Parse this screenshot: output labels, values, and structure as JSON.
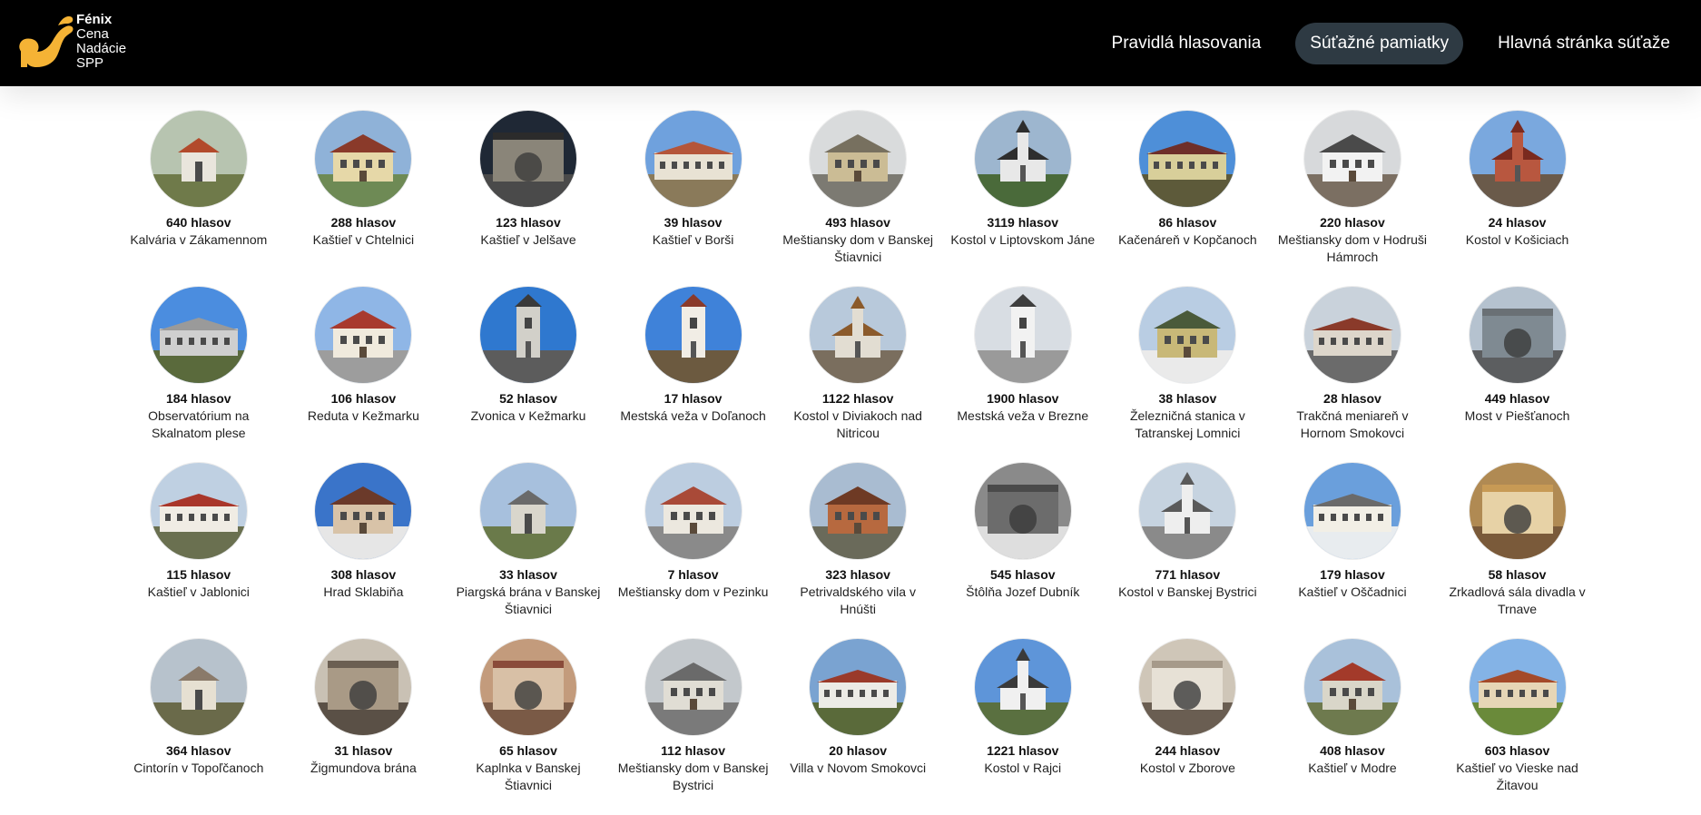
{
  "header": {
    "brand": [
      "Fénix",
      "Cena",
      "Nadácie",
      "SPP"
    ],
    "nav": [
      {
        "label": "Pravidlá hlasovania",
        "active": false
      },
      {
        "label": "Súťažné pamiatky",
        "active": true
      },
      {
        "label": "Hlavná stránka súťaže",
        "active": false
      }
    ]
  },
  "items": [
    {
      "votes": "640 hlasov",
      "name": "Kalvária v Zákamennom",
      "sky": "#b7c4b0",
      "ground": "#6f7a4a",
      "bld": "#e9e5dc",
      "roof": "#b24a2b",
      "shape": "chapel"
    },
    {
      "votes": "288 hlasov",
      "name": "Kaštieľ v Chtelnici",
      "sky": "#8fb2d8",
      "ground": "#6e8a55",
      "bld": "#e6d8a8",
      "roof": "#8a3a2a",
      "shape": "house"
    },
    {
      "votes": "123 hlasov",
      "name": "Kaštieľ v Jelšave",
      "sky": "#1f2835",
      "ground": "#4a4a4a",
      "bld": "#8a8579",
      "roof": "#2b2b2b",
      "shape": "wall"
    },
    {
      "votes": "39 hlasov",
      "name": "Kaštieľ v Borši",
      "sky": "#6fa1dd",
      "ground": "#8a7a5a",
      "bld": "#e8e2d4",
      "roof": "#b4553a",
      "shape": "long"
    },
    {
      "votes": "493 hlasov",
      "name": "Meštiansky dom v Banskej Štiavnici",
      "sky": "#d9dbdc",
      "ground": "#7c7a72",
      "bld": "#cbbc95",
      "roof": "#77705f",
      "shape": "house"
    },
    {
      "votes": "3119 hlasov",
      "name": "Kostol v Liptovskom Jáne",
      "sky": "#9db6cf",
      "ground": "#4a6a3a",
      "bld": "#e8e8e8",
      "roof": "#2e2e2e",
      "shape": "church"
    },
    {
      "votes": "86 hlasov",
      "name": "Kačenáreň v Kopčanoch",
      "sky": "#4e8fd8",
      "ground": "#5d5a3a",
      "bld": "#d8cf9a",
      "roof": "#6e2f2a",
      "shape": "long"
    },
    {
      "votes": "220 hlasov",
      "name": "Meštiansky dom v Hodruši Hámroch",
      "sky": "#d7d9db",
      "ground": "#7b6f62",
      "bld": "#f2f2f2",
      "roof": "#4a4a4a",
      "shape": "house"
    },
    {
      "votes": "24 hlasov",
      "name": "Kostol v Košiciach",
      "sky": "#7aa8de",
      "ground": "#6a5a4a",
      "bld": "#b8573f",
      "roof": "#7a2a1e",
      "shape": "church"
    },
    {
      "votes": "184 hlasov",
      "name": "Observatórium na Skalnatom plese",
      "sky": "#4b8ddf",
      "ground": "#5a6a3c",
      "bld": "#cfcfcf",
      "roof": "#9a9a9a",
      "shape": "long"
    },
    {
      "votes": "106 hlasov",
      "name": "Reduta v Kežmarku",
      "sky": "#8fb6e6",
      "ground": "#9d9d9d",
      "bld": "#f0eadd",
      "roof": "#a83a2e",
      "shape": "house"
    },
    {
      "votes": "52 hlasov",
      "name": "Zvonica v Kežmarku",
      "sky": "#2f78cf",
      "ground": "#5c5c5c",
      "bld": "#d2d0c9",
      "roof": "#3a3a3a",
      "shape": "tower"
    },
    {
      "votes": "17 hlasov",
      "name": "Mestská veža v Doľanoch",
      "sky": "#3f82d9",
      "ground": "#6c5a40",
      "bld": "#f1ede5",
      "roof": "#8a3a2a",
      "shape": "tower"
    },
    {
      "votes": "1122 hlasov",
      "name": "Kostol v Diviakoch nad Nitricou",
      "sky": "#b8c9db",
      "ground": "#7a6e5e",
      "bld": "#e2ddd2",
      "roof": "#8b5a2b",
      "shape": "church"
    },
    {
      "votes": "1900 hlasov",
      "name": "Mestská veža v Brezne",
      "sky": "#d8dde3",
      "ground": "#9a9a9a",
      "bld": "#f2f2f2",
      "roof": "#3e3e3e",
      "shape": "tower"
    },
    {
      "votes": "38 hlasov",
      "name": "Železničná stanica v Tatranskej Lomnici",
      "sky": "#b9cde3",
      "ground": "#eaeaea",
      "bld": "#c8b878",
      "roof": "#4a5a3a",
      "shape": "house"
    },
    {
      "votes": "28 hlasov",
      "name": "Trakčná meniareň v Hornom Smokovci",
      "sky": "#c9d2db",
      "ground": "#6b6b6b",
      "bld": "#ddd6cb",
      "roof": "#8a3a2a",
      "shape": "long"
    },
    {
      "votes": "449 hlasov",
      "name": "Most v Piešťanoch",
      "sky": "#b5c2cf",
      "ground": "#5c5e60",
      "bld": "#7f8a92",
      "roof": "#6a7075",
      "shape": "wall"
    },
    {
      "votes": "115 hlasov",
      "name": "Kaštieľ v Jablonici",
      "sky": "#bfd0e2",
      "ground": "#6a7050",
      "bld": "#f0ece4",
      "roof": "#a9362a",
      "shape": "long"
    },
    {
      "votes": "308 hlasov",
      "name": "Hrad Sklabiňa",
      "sky": "#3a74c9",
      "ground": "#e6e6e6",
      "bld": "#d8c3a8",
      "roof": "#6b3a2a",
      "shape": "house"
    },
    {
      "votes": "33 hlasov",
      "name": "Piargská brána v Banskej Štiavnici",
      "sky": "#a7c0dd",
      "ground": "#6a7a4a",
      "bld": "#d9d6cc",
      "roof": "#6a6a6a",
      "shape": "chapel"
    },
    {
      "votes": "7 hlasov",
      "name": "Meštiansky dom v Pezinku",
      "sky": "#bccde0",
      "ground": "#8a8a8a",
      "bld": "#ece8df",
      "roof": "#a94a38",
      "shape": "house"
    },
    {
      "votes": "323 hlasov",
      "name": "Petrivaldského vila v Hnúšti",
      "sky": "#a9bcd1",
      "ground": "#6a6a5a",
      "bld": "#b7693f",
      "roof": "#6e3a24",
      "shape": "house"
    },
    {
      "votes": "545 hlasov",
      "name": "Štôlňa Jozef Dubník",
      "sky": "#8a8a8a",
      "ground": "#dedede",
      "bld": "#6c6c6c",
      "roof": "#4a4a4a",
      "shape": "wall"
    },
    {
      "votes": "771 hlasov",
      "name": "Kostol v Banskej Bystrici",
      "sky": "#c6d3e0",
      "ground": "#8a8a8a",
      "bld": "#eeeeee",
      "roof": "#5a5a5a",
      "shape": "church"
    },
    {
      "votes": "179 hlasov",
      "name": "Kaštieľ v Oščadnici",
      "sky": "#6a9fdc",
      "ground": "#e8ecef",
      "bld": "#f2efe6",
      "roof": "#6a6a6a",
      "shape": "long"
    },
    {
      "votes": "58 hlasov",
      "name": "Zrkadlová sála divadla v Trnave",
      "sky": "#b08a53",
      "ground": "#7a5a3a",
      "bld": "#e7d2a6",
      "roof": "#c79a55",
      "shape": "wall"
    },
    {
      "votes": "364 hlasov",
      "name": "Cintorín v Topoľčanoch",
      "sky": "#b7c2cc",
      "ground": "#6a6a4a",
      "bld": "#e6e0d2",
      "roof": "#8a7a6a",
      "shape": "chapel"
    },
    {
      "votes": "31 hlasov",
      "name": "Žigmundova brána",
      "sky": "#c9c1b4",
      "ground": "#5a5046",
      "bld": "#a99a86",
      "roof": "#6b5f52",
      "shape": "wall"
    },
    {
      "votes": "65 hlasov",
      "name": "Kaplnka v Banskej Štiavnici",
      "sky": "#c39b7c",
      "ground": "#7a5a46",
      "bld": "#d8c0a6",
      "roof": "#8a4b3a",
      "shape": "wall"
    },
    {
      "votes": "112 hlasov",
      "name": "Meštiansky dom v Banskej Bystrici",
      "sky": "#c3c8cc",
      "ground": "#7a7a7a",
      "bld": "#e0ddd4",
      "roof": "#6a6a6a",
      "shape": "house"
    },
    {
      "votes": "20 hlasov",
      "name": "Villa v Novom Smokovci",
      "sky": "#7aa3d1",
      "ground": "#5a6a3a",
      "bld": "#ecebe6",
      "roof": "#9a3a2a",
      "shape": "long"
    },
    {
      "votes": "1221 hlasov",
      "name": "Kostol v Rajci",
      "sky": "#5e95d9",
      "ground": "#5a7040",
      "bld": "#f0f0f0",
      "roof": "#3a3a3a",
      "shape": "church"
    },
    {
      "votes": "244 hlasov",
      "name": "Kostol v Zborove",
      "sky": "#cfc6b8",
      "ground": "#6a5e52",
      "bld": "#e7e1d6",
      "roof": "#a69a8a",
      "shape": "wall"
    },
    {
      "votes": "408 hlasov",
      "name": "Kaštieľ v Modre",
      "sky": "#a9c1da",
      "ground": "#6e7a4e",
      "bld": "#d9d6c9",
      "roof": "#a33a2a",
      "shape": "house"
    },
    {
      "votes": "603 hlasov",
      "name": "Kaštieľ vo Vieske nad Žitavou",
      "sky": "#84b3e6",
      "ground": "#6a8a3a",
      "bld": "#e6d6b6",
      "roof": "#a44a2a",
      "shape": "long"
    }
  ]
}
